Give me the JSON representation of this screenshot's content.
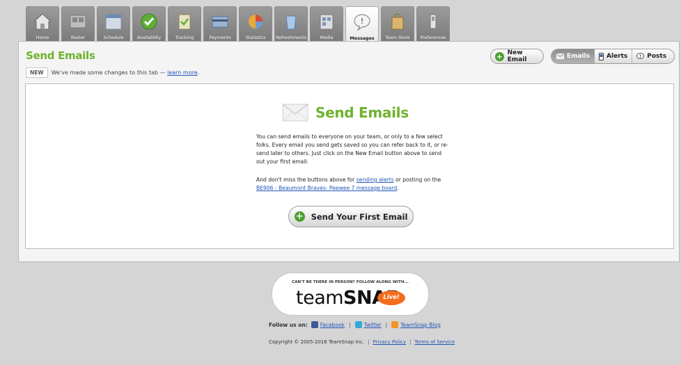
{
  "tabs": [
    {
      "label": "Home",
      "icon": "home-icon"
    },
    {
      "label": "Roster",
      "icon": "roster-icon"
    },
    {
      "label": "Schedule",
      "icon": "calendar-icon"
    },
    {
      "label": "Availability",
      "icon": "check-icon"
    },
    {
      "label": "Tracking",
      "icon": "clipboard-icon"
    },
    {
      "label": "Payments",
      "icon": "payment-icon"
    },
    {
      "label": "Statistics",
      "icon": "pie-chart-icon"
    },
    {
      "label": "Refreshments",
      "icon": "cup-icon"
    },
    {
      "label": "Media",
      "icon": "media-icon"
    },
    {
      "label": "Messages",
      "icon": "speech-bubble-icon",
      "active": true
    },
    {
      "label": "Team Store",
      "icon": "bag-icon"
    },
    {
      "label": "Preferences",
      "icon": "switch-icon"
    }
  ],
  "header": {
    "title": "Send Emails",
    "new_badge": "NEW",
    "notice_text": "We've made some changes to this tab —",
    "notice_link": "learn more",
    "notice_end": ".",
    "new_email_label": "New Email",
    "segments": {
      "emails": "Emails",
      "alerts": "Alerts",
      "posts": "Posts"
    }
  },
  "main": {
    "hero_title": "Send Emails",
    "description": "You can send emails to everyone on your team, or only to a few select folks. Every email you send gets saved so you can refer back to it, or re-send later to others. Just click on the New Email button above to send out your first email.",
    "desc2_prefix": "And don't miss the buttons above for",
    "desc2_link1": "sending alerts",
    "desc2_middle": "or posting on the",
    "desc2_link2": "BE906 - Beaumont Braves- Peewee 7 message board",
    "desc2_end": ".",
    "cta_label": "Send Your First Email"
  },
  "footer": {
    "live_tagline": "CAN'T BE THERE IN PERSON? FOLLOW ALONG WITH...",
    "brand_light": "team",
    "brand_bold": "SNAP",
    "live_badge": "Live!",
    "follow_label": "Follow us on:",
    "facebook": "Facebook",
    "twitter": "Twitter",
    "blog": "TeamSnap Blog",
    "copyright": "Copyright © 2005-2016 TeamSnap Inc.",
    "privacy": "Privacy Policy",
    "terms": "Terms of Service",
    "separator": "|"
  },
  "colors": {
    "accent": "#6fb22e",
    "link": "#2155b8",
    "live": "#f46d1c",
    "plus": "#4aa02c"
  }
}
